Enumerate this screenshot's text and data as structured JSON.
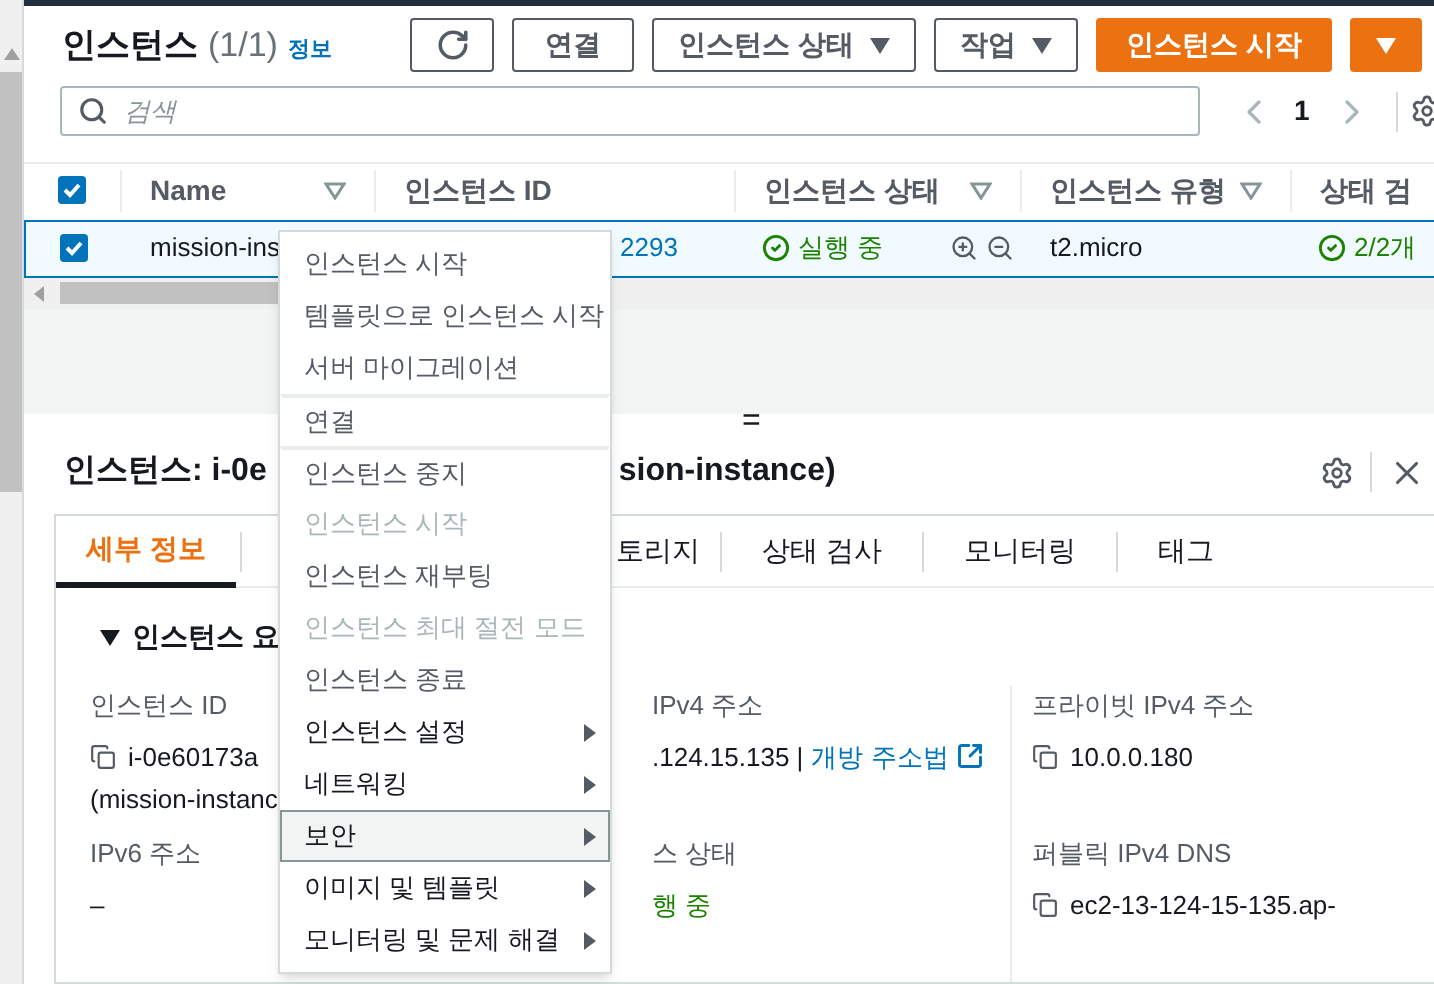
{
  "header": {
    "title": "인스턴스",
    "count": "(1/1)",
    "info_link": "정보"
  },
  "toolbar": [
    {
      "kind": "refresh"
    },
    {
      "kind": "plain",
      "label": "연결"
    },
    {
      "kind": "dropdown",
      "label": "인스턴스 상태"
    },
    {
      "kind": "dropdown",
      "label": "작업"
    },
    {
      "kind": "primary",
      "label": "인스턴스 시작"
    },
    {
      "kind": "primary-caret"
    }
  ],
  "search": {
    "placeholder": "검색"
  },
  "pagination": {
    "page": "1"
  },
  "table": {
    "columns": [
      {
        "label": "Name",
        "filter": true
      },
      {
        "label": "인스턴스 ID",
        "filter": false
      },
      {
        "label": "인스턴스 상태",
        "filter": true
      },
      {
        "label": "인스턴스 유형",
        "filter": true
      },
      {
        "label": "상태 검",
        "filter": false
      }
    ],
    "rows": [
      {
        "selected": true,
        "name": "mission-ins",
        "instance_id": "2293",
        "state": "실행 중",
        "type": "t2.micro",
        "check": "2/2개"
      }
    ]
  },
  "detail": {
    "title_left": "인스턴스: i-0e",
    "title_right": "sion-instance)",
    "tabs": [
      {
        "label": "세부 정보",
        "selected": true
      },
      {
        "label": "토리지",
        "selected": false
      },
      {
        "label": "상태 검사",
        "selected": false
      },
      {
        "label": "모니터링",
        "selected": false
      },
      {
        "label": "태그",
        "selected": false
      }
    ],
    "section_title": "인스턴스 요",
    "fields": [
      {
        "kind": "copy",
        "label": "인스턴스 ID",
        "value": "i-0e60173a",
        "value_2": "(mission-instanc"
      },
      {
        "kind": "link",
        "label": "IPv4 주소",
        "value": ".124.15.135 |",
        "link": "개방 주소법"
      },
      {
        "kind": "copy",
        "label": "프라이빗 IPv4 주소",
        "value": "10.0.0.180"
      },
      {
        "kind": "text",
        "label": "IPv6 주소",
        "value": "–"
      },
      {
        "kind": "status",
        "label": "스 상태",
        "value": "행 중"
      },
      {
        "kind": "copy",
        "label": "퍼블릭 IPv4 DNS",
        "value": "ec2-13-124-15-135.ap-"
      }
    ]
  },
  "context_menu": [
    {
      "label": "인스턴스 시작",
      "disabled": false,
      "submenu": false,
      "selected": false,
      "group_start": false
    },
    {
      "label": "템플릿으로 인스턴스 시작",
      "disabled": false,
      "submenu": false,
      "selected": false,
      "group_start": false
    },
    {
      "label": "서버 마이그레이션",
      "disabled": false,
      "submenu": false,
      "selected": false,
      "group_start": false
    },
    {
      "label": "연결",
      "disabled": false,
      "submenu": false,
      "selected": false,
      "group_start": true
    },
    {
      "label": "인스턴스 중지",
      "disabled": false,
      "submenu": false,
      "selected": false,
      "group_start": true
    },
    {
      "label": "인스턴스 시작",
      "disabled": true,
      "submenu": false,
      "selected": false,
      "group_start": false
    },
    {
      "label": "인스턴스 재부팅",
      "disabled": false,
      "submenu": false,
      "selected": false,
      "group_start": false
    },
    {
      "label": "인스턴스 최대 절전 모드",
      "disabled": true,
      "submenu": false,
      "selected": false,
      "group_start": false
    },
    {
      "label": "인스턴스 종료",
      "disabled": false,
      "submenu": false,
      "selected": false,
      "group_start": false
    },
    {
      "label": "인스턴스 설정",
      "disabled": false,
      "submenu": true,
      "selected": false,
      "group_start": false
    },
    {
      "label": "네트워킹",
      "disabled": false,
      "submenu": true,
      "selected": false,
      "group_start": false
    },
    {
      "label": "보안",
      "disabled": false,
      "submenu": true,
      "selected": true,
      "group_start": false
    },
    {
      "label": "이미지 및 템플릿",
      "disabled": false,
      "submenu": true,
      "selected": false,
      "group_start": false
    },
    {
      "label": "모니터링 및 문제 해결",
      "disabled": false,
      "submenu": true,
      "selected": false,
      "group_start": false
    }
  ],
  "resize_handle": "="
}
